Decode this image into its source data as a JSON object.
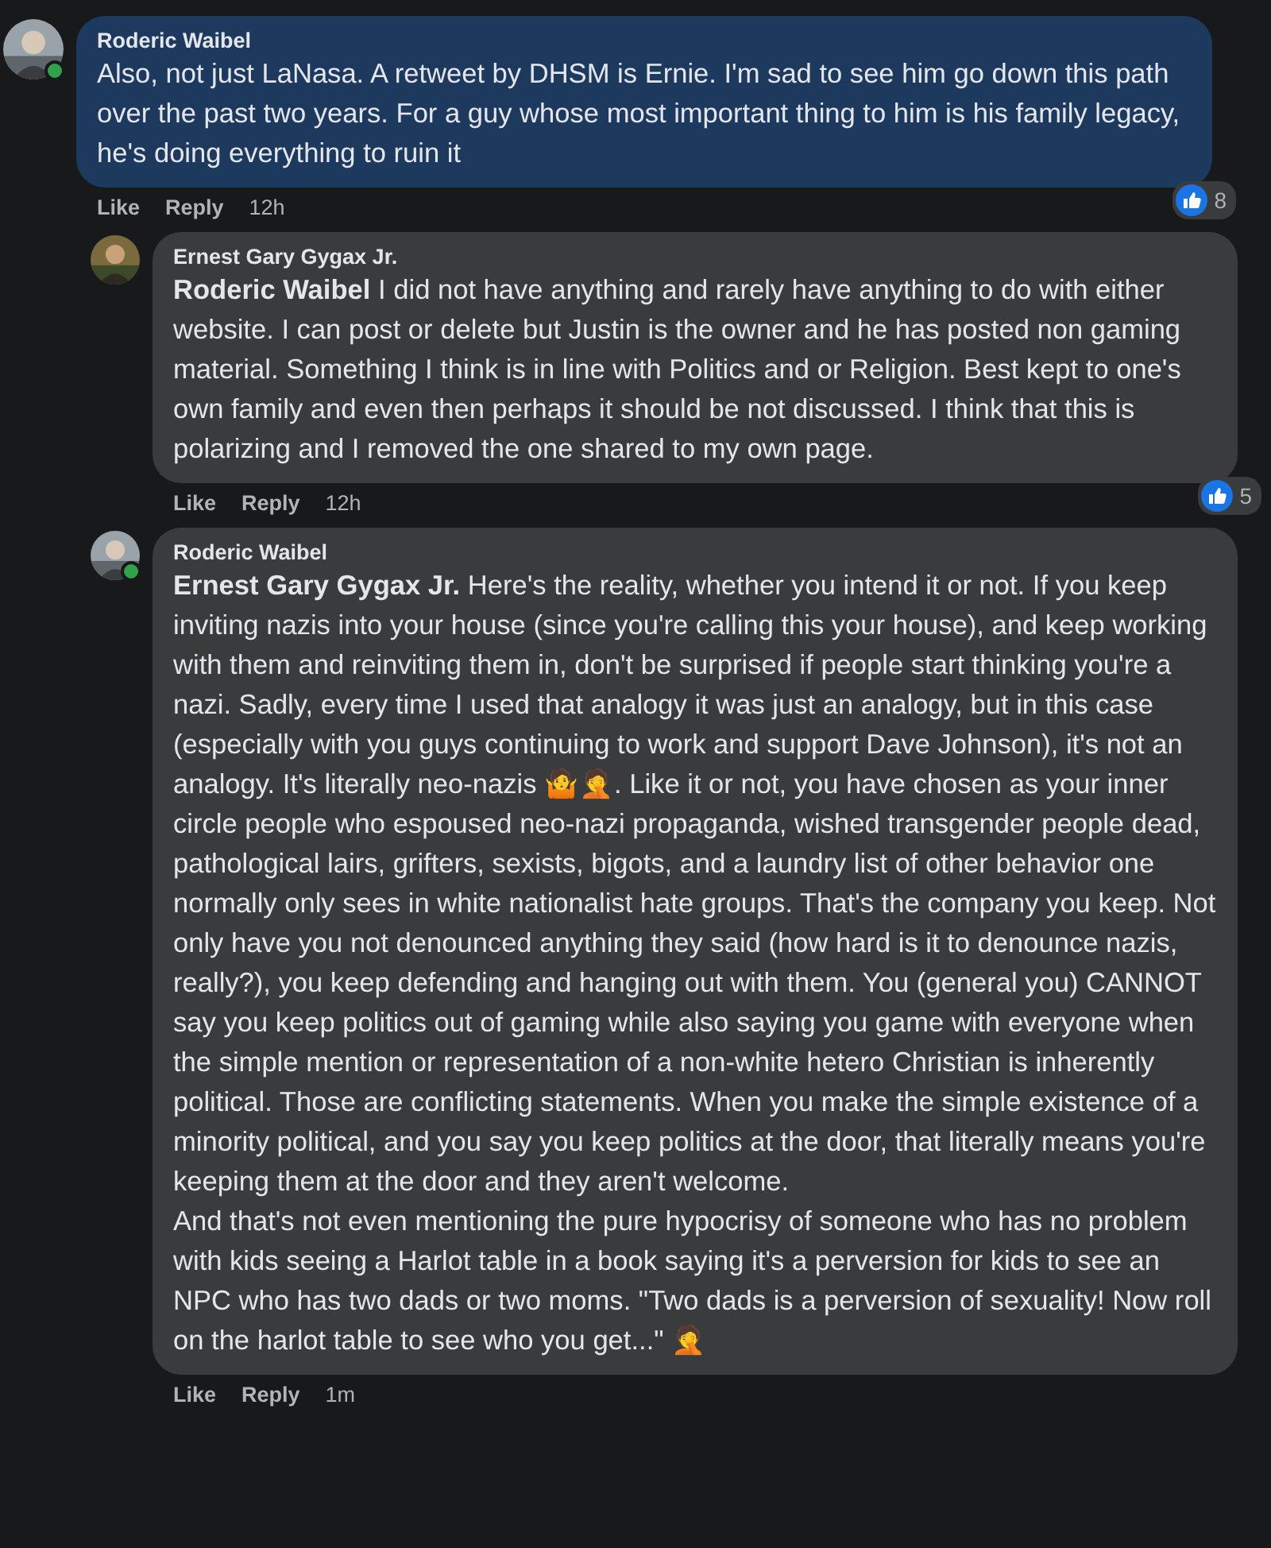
{
  "comments": [
    {
      "kind": "top",
      "author": "Roderic Waibel",
      "online": true,
      "paragraphs": [
        "Also, not just LaNasa. A retweet by DHSM is Ernie. I'm sad to see him go down this path over the past two years. For a guy whose most important thing to him is his family legacy, he's doing everything to ruin it"
      ],
      "highlighted": true,
      "actions": [
        "Like",
        "Reply"
      ],
      "time": "12h",
      "reaction_count": "8"
    },
    {
      "kind": "reply",
      "author": "Ernest Gary Gygax Jr.",
      "online": false,
      "mention": "Roderic Waibel",
      "paragraphs": [
        "I did not have anything and rarely have anything to do with either website. I can post or delete but Justin is the owner and he has posted non gaming material. Something I think is in line with Politics and or Religion. Best kept to one's own family and even then perhaps it should be not discussed. I think that this is polarizing and I removed the one shared to my own page."
      ],
      "highlighted": false,
      "actions": [
        "Like",
        "Reply"
      ],
      "time": "12h",
      "reaction_count": "5"
    },
    {
      "kind": "reply",
      "author": "Roderic Waibel",
      "online": true,
      "mention": "Ernest Gary Gygax Jr.",
      "paragraphs": [
        "Here's the reality, whether you intend it or not. If you keep inviting nazis into your house (since you're calling this your house), and keep working with them and reinviting them in, don't be surprised if people start thinking you're a nazi. Sadly, every time I used that analogy it was just an analogy, but in this case (especially with you guys continuing to work and support Dave Johnson), it's not an analogy. It's literally neo-nazis 🤷🤦. Like it or not, you have chosen as your inner circle people who espoused neo-nazi propaganda, wished transgender people dead, pathological lairs, grifters, sexists, bigots, and a laundry list of other behavior one normally only sees in white nationalist hate groups. That's the company you keep. Not only have you not denounced anything they said (how hard is it to denounce nazis, really?), you keep defending and hanging out with them. You (general you) CANNOT say you keep politics out of gaming while also saying you game with everyone when the simple mention or representation of a non-white hetero Christian is inherently political. Those are conflicting statements. When you make the simple existence of a minority political, and you say you keep politics at the door, that literally means you're keeping them at the door and they aren't welcome.",
        "And that's not even mentioning the pure hypocrisy of someone who has no problem with kids seeing a Harlot table in a book saying it's a perversion for kids to see an NPC who has two dads or two moms. \"Two dads is a perversion of sexuality! Now roll on the harlot table to see who you get...\" 🤦"
      ],
      "highlighted": false,
      "actions": [
        "Like",
        "Reply"
      ],
      "time": "1m"
    }
  ]
}
